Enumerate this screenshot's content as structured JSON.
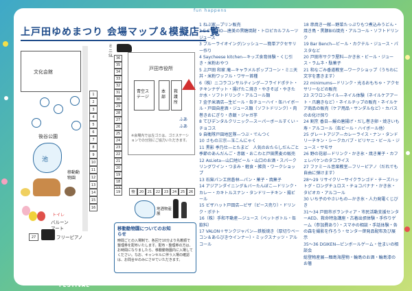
{
  "title": "上戸田ゆめまつり 会場マップ＆模擬店一覧",
  "top_text": "fun happens",
  "bottom_text": "FESTIVAL",
  "map": {
    "bunka_kaikan": "文化会館",
    "koen": "後谷公園",
    "ike": "池",
    "idou_doubutsuen": "移動動物園",
    "mini_sl": "ミニSL",
    "toda_shiyakusho": "戸田市役所",
    "aozora_stage": "青空ステージ",
    "honbu": "本部",
    "kyugo_sho": "救護所",
    "sake_butten": "地酒物産展",
    "balloon_art": "バルーンアート",
    "toilet": "トイレ",
    "free_piano": "フリーピアノ",
    "furea_1": "ふあ",
    "furea_2": "ふあ",
    "note": "※会場内では左ゴミは、ゴミステーションでの分別にご協力いただきます。",
    "info_title": "移動動物園についてのお知らせ",
    "info_body": "時間ごとの入場制で、各回で10分より先着順で整理券を配布いたします。配布・整理券の方は、お時間になりましたら、移動動物園内に入場してください。なお、キャンセルに伴う入場の確認は、お問合せのみにさせていただきます。",
    "left_cells": [
      "1",
      "2",
      "3",
      "4",
      "5",
      "6",
      "7",
      "8",
      "9",
      "10",
      "11",
      "12",
      "13",
      "14",
      "15",
      "16"
    ],
    "mid_cells": [
      "36",
      "35",
      "34",
      "33",
      "32",
      "31",
      "30",
      "29",
      "28",
      "27",
      "26",
      "25",
      "24",
      "23",
      "22",
      "21",
      "20",
      "19",
      "18",
      "17"
    ],
    "bottom_cells": [
      "19",
      "物",
      "20",
      "21",
      "22",
      "23",
      "24",
      "25",
      "26"
    ],
    "piano_cell": "27"
  },
  "list_col1": [
    "1 ねぶ家—プリン販売",
    "2 E STUDIO—唐美の黒糖焼酎・トロピカルフルーツジュース",
    "3 ブルーライオイング/ンッシュー—簡単アクセサリー作り",
    "4 Saycheese kitchen—キッズ食育体験・くじ引き・米粉おやつ",
    "5 上戸田 和家 庵—キャラメルポップコーン・ミニ天丼・米粉ワッフル・ワサー首種",
    "6（株）ニコラコンサルティング—フライドポテト・チキンナゲット・揚げたこ焼き・やきそば・やきたか水・ソフトドリンク・アルコール類",
    "7 金子米酒店—生ビール・缶チューハイ・缶ハイボール・戸田自産酒・ジュース類（ソフトドリンク）・肉巻きおにぎり・赤飯・ジャガ芋",
    "8 てびデンタルクリニック—スーパーボールすくい・チョコス",
    "9 自衛隊戸田地区隊—つぶ・でんつく",
    "10 さもの三宗—玉こんにゃく",
    "11 黒影 季乃仕—とたまど　人気のおたらしだんごと季節のあんだんご・赤飯・おこわと戸田黒麦の販売",
    "12 AsLieta—山口地ビール・山口のお酒・スパークリングワイン・つまみ・軽食・雑貨・ワークショップ",
    "13 石窯パン工房蒼林—パン・菓子・焼菓子",
    "14 アジアンダイニング＆バーたんぼこ—ドリンク・カレー・カキトルスナン・タンドリーチキン・揚ビール",
    "15 ビザハット戸田店—ピザ（ピース売り）・ドリンク・ポテト",
    "16（株）手和不動産—ジュース（ペットボトル・缶飲料）",
    "17 VALON＋サンクジャパン—鉄板焼き（厚切りベーコン＆あらびきウインナー）・ミックスナッツ・アルコール"
  ],
  "list_col2": [
    "18 串焼き一献—野菜たっぷりもつ煮込みうどん・焼き鳥・黒豚BIG焼売・アルコール・ソフトドリンク",
    "19 Bar Bench—ビール・カクテル・ジュース・パスタなど",
    "20 戸田市サクラ屋料—かき氷・ビール・ジュース・ラムネ・駄菓子",
    "21 和なごみ香道教室—ワークショップ（うちわに文字を書きます）",
    "22 minimums—ドリンク・光るおもちゃ・アクセサリーなどの販売",
    "23 スワロンネイル—ネイル体験（ネイルケアアート・爪磨きなど）・ネイルチップの販売・ネイルケア商品の販売（ケア用品・サンダルなど）・カバスのお化け探り",
    "24 割烹 香日—鰻の唐揚げ・だし巻き卵・焼きいも寿・アルコール（缶ビール・ハイボール他）",
    "25 グレートアジア—カレーライス・ナン・タンドリーチキン・シークカバブ・ビリヤニ・ビール・ジュース・サモサ",
    "26 野の花邸—ドリンク・かき氷・焼き菓子・カフェレパケンのタコライス",
    "27 ファミール音楽教室—フリーピアノ（だれでも自由に弾けます）",
    "28～29 リサイクリーサイクランゴド・チーズハットグ・ロングチュロス・チョコバナナ・かき氷・タピオカ・アルコール",
    "30 いち子のやさいもの—かき氷・人力発電くじびき",
    "31～34 戸田市ボランティア・市民活動支援センターAED、救命特急講座・古着出張体験・手作りゲーム（参加費あり）・スマホの相談・手話体験・各の森を撮影を作ろう・センター啓発品配布及び展示",
    "35～36 DGIKEN—ピンボールゲーム・住まいの相談会",
    "総登物産展—麺島海屋物・輪島のお酒・輪島漆のお箸"
  ]
}
